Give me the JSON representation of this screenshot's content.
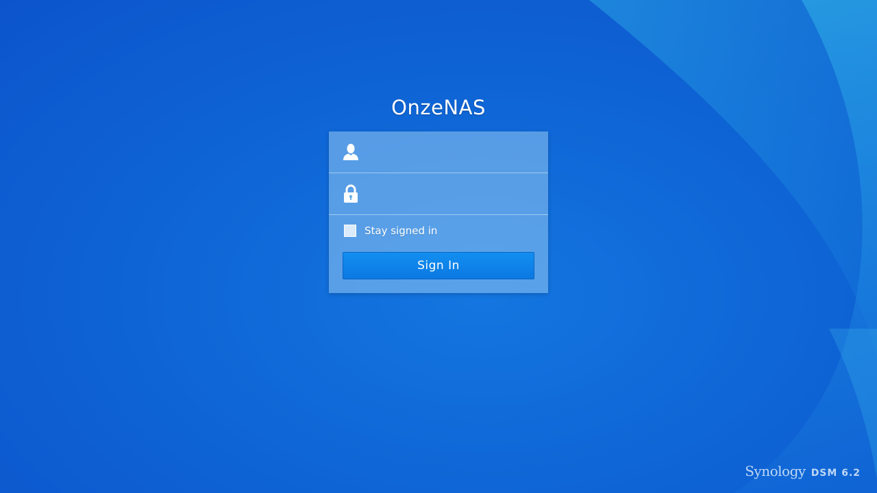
{
  "login": {
    "server_name": "OnzeNAS",
    "username_icon": "user-icon",
    "username_value": "",
    "username_placeholder": "",
    "password_icon": "lock-icon",
    "password_value": "",
    "password_placeholder": "",
    "stay_signed_in_label": "Stay signed in",
    "stay_signed_in_checked": false,
    "sign_in_label": "Sign In"
  },
  "branding": {
    "vendor": "Synology",
    "product": "DSM 6.2"
  },
  "colors": {
    "background": "#0f66d6",
    "panel": "#8cc3f0",
    "button": "#0b84ea",
    "text": "#ffffff"
  }
}
